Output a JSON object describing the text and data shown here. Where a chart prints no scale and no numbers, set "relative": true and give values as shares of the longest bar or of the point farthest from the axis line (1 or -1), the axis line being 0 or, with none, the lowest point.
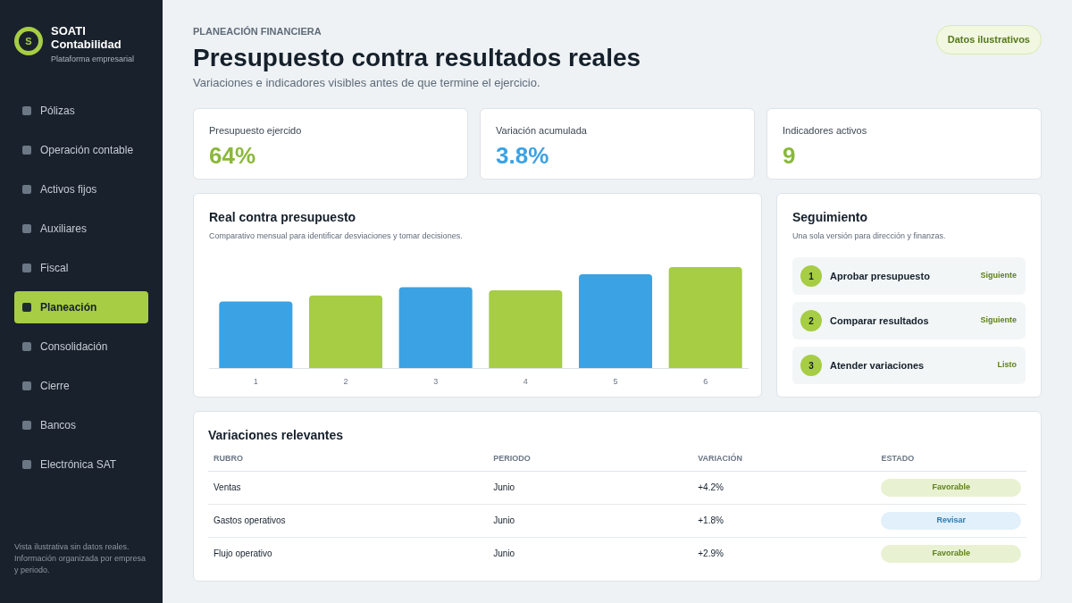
{
  "sidebar": {
    "brand": {
      "logo_letter": "S",
      "name": "SOATI Contabilidad",
      "tagline": "Plataforma empresarial"
    },
    "items": [
      {
        "label": "Pólizas",
        "selected": false
      },
      {
        "label": "Operación contable",
        "selected": false
      },
      {
        "label": "Activos fijos",
        "selected": false
      },
      {
        "label": "Auxiliares",
        "selected": false
      },
      {
        "label": "Fiscal",
        "selected": false
      },
      {
        "label": "Planeación",
        "selected": true
      },
      {
        "label": "Consolidación",
        "selected": false
      },
      {
        "label": "Cierre",
        "selected": false
      },
      {
        "label": "Bancos",
        "selected": false
      },
      {
        "label": "Electrónica SAT",
        "selected": false
      }
    ],
    "footer": "Vista ilustrativa sin datos reales. Información organizada por empresa y periodo."
  },
  "header": {
    "eyebrow": "PLANEACIÓN FINANCIERA",
    "title": "Presupuesto contra resultados reales",
    "subtitle": "Variaciones e indicadores visibles antes de que termine el ejercicio.",
    "badge": "Datos ilustrativos"
  },
  "kpis": [
    {
      "label": "Presupuesto ejercido",
      "value": "64%",
      "color": "#8ab83a"
    },
    {
      "label": "Variación acumulada",
      "value": "3.8%",
      "color": "#3ba2e3"
    },
    {
      "label": "Indicadores activos",
      "value": "9",
      "color": "#8ab83a"
    }
  ],
  "chart_card": {
    "title": "Real contra presupuesto",
    "subtitle": "Comparativo mensual para identificar desviaciones y tomar decisiones.",
    "chart_data": {
      "type": "bar",
      "relative": true,
      "categories": [
        "1",
        "2",
        "3",
        "4",
        "5",
        "6"
      ],
      "values": [
        0.66,
        0.72,
        0.8,
        0.77,
        0.93,
        1
      ],
      "colors": [
        "#3ba2e3",
        "#a6cd44",
        "#3ba2e3",
        "#a6cd44",
        "#3ba2e3",
        "#a6cd44"
      ]
    }
  },
  "tracking": {
    "title": "Seguimiento",
    "subtitle": "Una sola versión para dirección y finanzas.",
    "steps": [
      {
        "number": "1",
        "label": "Aprobar presupuesto",
        "status": "Siguiente"
      },
      {
        "number": "2",
        "label": "Comparar resultados",
        "status": "Siguiente"
      },
      {
        "number": "3",
        "label": "Atender variaciones",
        "status": "Listo"
      }
    ]
  },
  "table": {
    "title": "Variaciones relevantes",
    "columns": [
      "RUBRO",
      "PERIODO",
      "VARIACIÓN",
      "ESTADO"
    ],
    "rows": [
      {
        "rubro": "Ventas",
        "periodo": "Junio",
        "variacion": "+4.2%",
        "estado": {
          "text": "Favorable",
          "kind": "favorable"
        }
      },
      {
        "rubro": "Gastos operativos",
        "periodo": "Junio",
        "variacion": "+1.8%",
        "estado": {
          "text": "Revisar",
          "kind": "review"
        }
      },
      {
        "rubro": "Flujo operativo",
        "periodo": "Junio",
        "variacion": "+2.9%",
        "estado": {
          "text": "Favorable",
          "kind": "favorable"
        }
      }
    ]
  }
}
